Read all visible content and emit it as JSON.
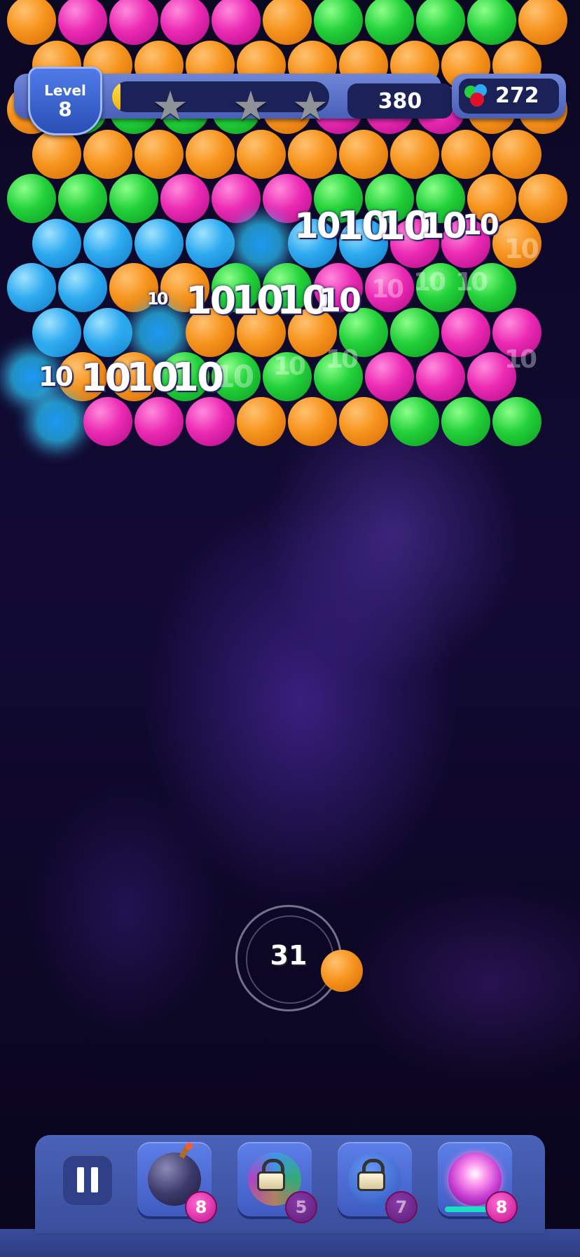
{
  "level": {
    "label": "Level",
    "number": "8"
  },
  "progress": {
    "fill_fraction": 0.04,
    "stars_earned": 0,
    "stars_total": 3
  },
  "score": "380",
  "bubbles_currency": "272",
  "colors": {
    "orange": "#f7941d",
    "pink": "#ec2ab4",
    "green": "#22d13a",
    "blue": "#2eaaf0",
    "panel": "#4a5fb8",
    "star_empty": "#8f9296"
  },
  "board_rows": [
    [
      "orange",
      "pink",
      "pink",
      "pink",
      "pink",
      "orange",
      "green",
      "green",
      "green",
      "green",
      "orange"
    ],
    [
      "orange",
      "orange",
      "orange",
      "orange",
      "orange",
      "orange",
      "orange",
      "orange",
      "orange",
      "orange"
    ],
    [
      "orange",
      "green",
      "green",
      "green",
      "green",
      "orange",
      "pink",
      "pink",
      "pink",
      "orange",
      "orange"
    ],
    [
      "orange",
      "orange",
      "orange",
      "orange",
      "orange",
      "orange",
      "orange",
      "orange",
      "orange",
      "orange"
    ],
    [
      "green",
      "green",
      "green",
      "pink",
      "pink",
      "pink",
      "green",
      "green",
      "green",
      "orange",
      "orange"
    ],
    [
      "blue",
      "blue",
      "blue",
      "blue",
      "burst",
      "blue",
      "blue",
      "pink",
      "pink",
      "orange"
    ],
    [
      "blue",
      "blue",
      "orange",
      "orange",
      "green",
      "green",
      "pink",
      "pink",
      "green",
      "green"
    ],
    [
      "blue",
      "blue",
      "burst",
      "orange",
      "orange",
      "orange",
      "green",
      "green",
      "pink",
      "pink"
    ],
    [
      "burst",
      "orange",
      "orange",
      "green",
      "green",
      "green",
      "green",
      "pink",
      "pink",
      "pink"
    ],
    [
      "burst",
      "pink",
      "pink",
      "pink",
      "orange",
      "orange",
      "orange",
      "green",
      "green",
      "green"
    ]
  ],
  "score_popups": [
    {
      "text": "10",
      "size": "big"
    },
    {
      "text": "10",
      "size": "big"
    },
    {
      "text": "10",
      "size": "big"
    },
    {
      "text": "10",
      "size": "big"
    },
    {
      "text": "10",
      "size": "med"
    },
    {
      "text": "10",
      "size": "faded"
    },
    {
      "text": "10",
      "size": "small"
    },
    {
      "text": "10",
      "size": "big"
    },
    {
      "text": "10",
      "size": "big"
    },
    {
      "text": "10",
      "size": "big"
    },
    {
      "text": "10",
      "size": "med"
    },
    {
      "text": "10",
      "size": "faded"
    },
    {
      "text": "10",
      "size": "faded"
    },
    {
      "text": "10",
      "size": "faded"
    },
    {
      "text": "10",
      "size": "big"
    },
    {
      "text": "10",
      "size": "big"
    },
    {
      "text": "10",
      "size": "big"
    },
    {
      "text": "10",
      "size": "med"
    },
    {
      "text": "10",
      "size": "faded"
    },
    {
      "text": "10",
      "size": "faded"
    },
    {
      "text": "10",
      "size": "faded"
    },
    {
      "text": "10",
      "size": "faded"
    }
  ],
  "shooter": {
    "shots_left": "31",
    "next_bubble_color": "orange"
  },
  "toolbar": {
    "pause_icon": "pause-icon",
    "boosters": [
      {
        "name": "bomb",
        "icon": "bomb-icon",
        "count": "8",
        "locked": false
      },
      {
        "name": "rainbow",
        "icon": "lock-icon",
        "count": "5",
        "locked": true
      },
      {
        "name": "fire",
        "icon": "lock-icon",
        "count": "7",
        "locked": true
      },
      {
        "name": "lightning",
        "icon": "lightning-orb-icon",
        "count": "8",
        "locked": false
      }
    ]
  }
}
